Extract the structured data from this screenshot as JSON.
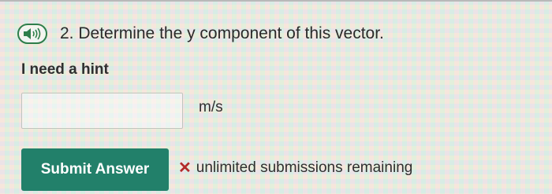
{
  "question": {
    "number": "2.",
    "text": "Determine the y component of this vector.",
    "audio_icon": "speaker-icon"
  },
  "hint": {
    "label": "I need a hint"
  },
  "answer": {
    "value": "",
    "placeholder": "",
    "unit": "m/s"
  },
  "submit": {
    "label": "Submit Answer",
    "color": "#22806a"
  },
  "submissions": {
    "status_icon": "x-icon",
    "status_color": "#b22a2a",
    "text": "unlimited submissions remaining"
  }
}
